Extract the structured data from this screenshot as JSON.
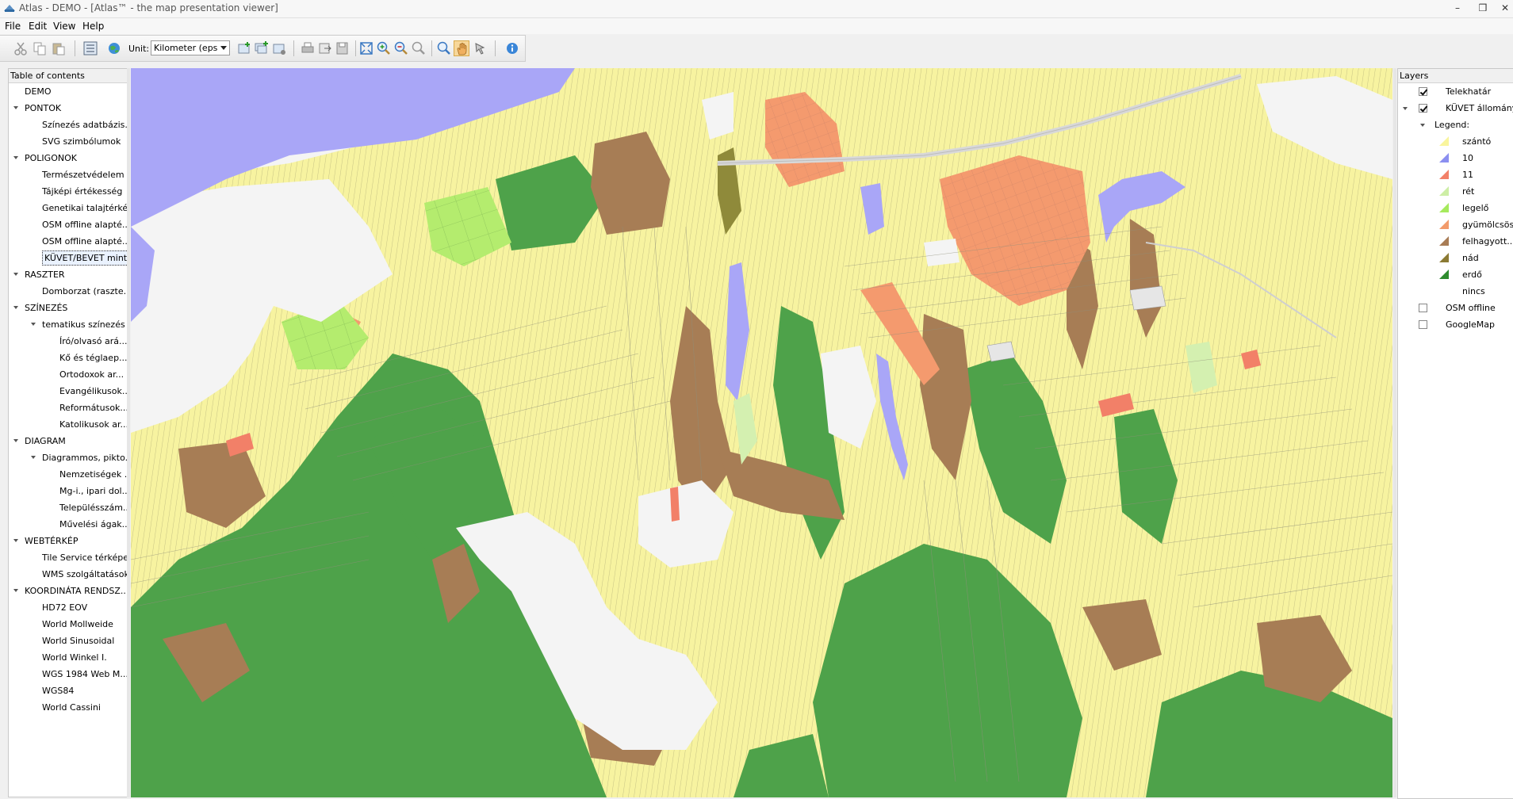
{
  "window": {
    "title": "Atlas - DEMO - [Atlas™ - the map presentation viewer]",
    "buttons": {
      "minimize": "–",
      "restore": "❒",
      "close": "✕"
    }
  },
  "menu": [
    "File",
    "Edit",
    "View",
    "Help"
  ],
  "toolbar": {
    "unit_label": "Unit:",
    "unit_value": "Kilometer (eps",
    "icons": [
      "cut-icon",
      "copy-icon",
      "paste-icon",
      "toc-toggle-icon",
      "globe-icon",
      "add-layer-icon",
      "add-group-icon",
      "remove-layer-icon",
      "print-icon",
      "export-icon",
      "save-icon",
      "zoom-extent-icon",
      "zoom-in-icon",
      "zoom-out-icon",
      "zoom-window-icon",
      "search-icon",
      "pan-hand-icon",
      "select-icon",
      "info-icon"
    ]
  },
  "toc": {
    "header": "Table of contents",
    "items": [
      {
        "label": "DEMO",
        "level": 0,
        "expandable": false
      },
      {
        "label": "PONTOK",
        "level": 0,
        "expandable": true
      },
      {
        "label": "Színezés adatbázis...",
        "level": 1,
        "expandable": false
      },
      {
        "label": "SVG szimbólumok",
        "level": 1,
        "expandable": false
      },
      {
        "label": "POLIGONOK",
        "level": 0,
        "expandable": true
      },
      {
        "label": "Természetvédelem",
        "level": 1,
        "expandable": false
      },
      {
        "label": "Tájképi értékesség",
        "level": 1,
        "expandable": false
      },
      {
        "label": "Genetikai talajtérkép",
        "level": 1,
        "expandable": false
      },
      {
        "label": "OSM offline alapté...",
        "level": 1,
        "expandable": false
      },
      {
        "label": "OSM offline alapté...",
        "level": 1,
        "expandable": false
      },
      {
        "label": "KÜVET/BEVET minta",
        "level": 1,
        "expandable": false,
        "selected": true
      },
      {
        "label": "RASZTER",
        "level": 0,
        "expandable": true
      },
      {
        "label": "Domborzat (raszte...",
        "level": 1,
        "expandable": false
      },
      {
        "label": "SZÍNEZÉS",
        "level": 0,
        "expandable": true
      },
      {
        "label": "tematikus színezés",
        "level": 1,
        "expandable": true
      },
      {
        "label": "Író/olvasó ará...",
        "level": 2,
        "expandable": false
      },
      {
        "label": "Kő és téglaep...",
        "level": 2,
        "expandable": false
      },
      {
        "label": "Ortodoxok ar...",
        "level": 2,
        "expandable": false
      },
      {
        "label": "Evangélikusok...",
        "level": 2,
        "expandable": false
      },
      {
        "label": "Reformátusok...",
        "level": 2,
        "expandable": false
      },
      {
        "label": "Katolikusok ar...",
        "level": 2,
        "expandable": false
      },
      {
        "label": "DIAGRAM",
        "level": 0,
        "expandable": true
      },
      {
        "label": "Diagrammos, pikto...",
        "level": 1,
        "expandable": true
      },
      {
        "label": "Nemzetiségek ...",
        "level": 2,
        "expandable": false
      },
      {
        "label": "Mg-i., ipari dol...",
        "level": 2,
        "expandable": false
      },
      {
        "label": "Településszám...",
        "level": 2,
        "expandable": false
      },
      {
        "label": "Művelési ágak...",
        "level": 2,
        "expandable": false
      },
      {
        "label": "WEBTÉRKÉP",
        "level": 0,
        "expandable": true
      },
      {
        "label": "Tile Service térképek",
        "level": 1,
        "expandable": false
      },
      {
        "label": "WMS szolgáltatások",
        "level": 1,
        "expandable": false
      },
      {
        "label": "KOORDINÁTA RENDSZ...",
        "level": 0,
        "expandable": true
      },
      {
        "label": "HD72 EOV",
        "level": 1,
        "expandable": false
      },
      {
        "label": "World Mollweide",
        "level": 1,
        "expandable": false
      },
      {
        "label": "World Sinusoidal",
        "level": 1,
        "expandable": false
      },
      {
        "label": "World Winkel I.",
        "level": 1,
        "expandable": false
      },
      {
        "label": "WGS 1984 Web M...",
        "level": 1,
        "expandable": false
      },
      {
        "label": "WGS84",
        "level": 1,
        "expandable": false
      },
      {
        "label": "World Cassini",
        "level": 1,
        "expandable": false
      }
    ]
  },
  "layers": {
    "header": "Layers",
    "items": [
      {
        "label": "Telekhatár",
        "type": "layer",
        "checked": true
      },
      {
        "label": "KÜVET állomány",
        "type": "layer",
        "checked": true,
        "expanded": true
      },
      {
        "label": "Legend:",
        "type": "legend-head"
      },
      {
        "label": "szántó",
        "type": "legend",
        "color": "#f9f59d"
      },
      {
        "label": "10",
        "type": "legend",
        "color": "#8b8ff0"
      },
      {
        "label": "11",
        "type": "legend",
        "color": "#f28068"
      },
      {
        "label": "rét",
        "type": "legend",
        "color": "#cdeea5"
      },
      {
        "label": "legelő",
        "type": "legend",
        "color": "#a6ea5d"
      },
      {
        "label": "gyümölcsös",
        "type": "legend",
        "color": "#f29b6b"
      },
      {
        "label": "felhagyott...",
        "type": "legend",
        "color": "#a87c55"
      },
      {
        "label": "nád",
        "type": "legend",
        "color": "#8b7a33"
      },
      {
        "label": "erdő",
        "type": "legend",
        "color": "#2e8b2e"
      },
      {
        "label": "nincs",
        "type": "legend",
        "color": null
      },
      {
        "label": "OSM offline",
        "type": "layer",
        "checked": false
      },
      {
        "label": "GoogleMap",
        "type": "layer",
        "checked": false
      }
    ]
  },
  "map_colors": {
    "background": "#f4f4f4",
    "water": "#a9a6f7",
    "arable": "#f7f3a0",
    "forest": "#4ea24a",
    "fallow": "#a77d55",
    "orchard": "#f49a6e",
    "pasture": "#b4ec6e",
    "meadow": "#d4f0b0",
    "reed": "#8f8a3a",
    "parcel_line": "#9a9a7a"
  }
}
